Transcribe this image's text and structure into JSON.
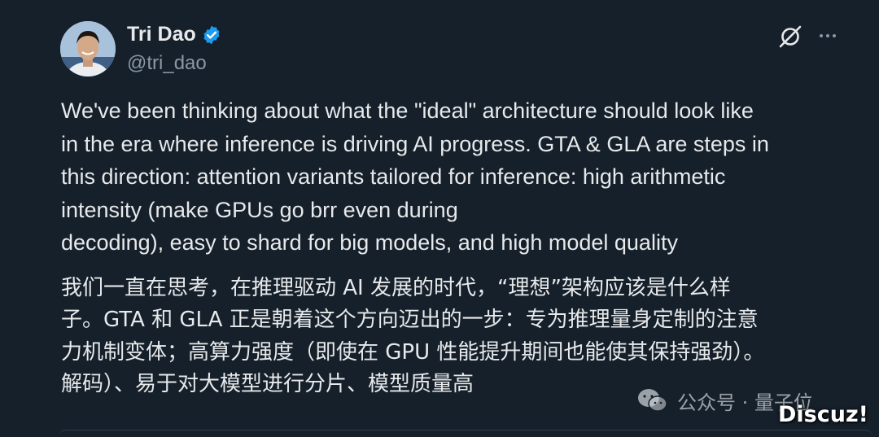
{
  "author": {
    "display_name": "Tri Dao",
    "handle": "@tri_dao",
    "verified_icon": "verified-badge-icon"
  },
  "actions": {
    "grok_icon": "grok-icon",
    "more_icon": "more-icon"
  },
  "tweet": {
    "english_lines": [
      "We've been thinking about what the \"ideal\" architecture should look like",
      "in the era where inference is driving AI progress. GTA & GLA are steps in",
      "this direction: attention variants tailored for inference: high arithmetic",
      "intensity (make GPUs go brr even during",
      "decoding), easy to shard for big models, and high model quality"
    ],
    "chinese_lines": [
      "我们一直在思考，在推理驱动 AI 发展的时代，“理想”架构应该是什么样",
      "子。GTA 和 GLA 正是朝着这个方向迈出的一步：专为推理量身定制的注意",
      "力机制变体；高算力强度（即使在 GPU 性能提升期间也能使其保持强劲）。",
      "解码）、易于对大模型进行分片、模型质量高"
    ]
  },
  "watermark": {
    "text": "公众号 · 量子位",
    "icon": "wechat-icon",
    "forum_mark": "Discuz!"
  },
  "colors": {
    "background": "#15202b",
    "text": "#e7e9ea",
    "secondary": "#8b98a5",
    "verified": "#1d9bf0"
  }
}
